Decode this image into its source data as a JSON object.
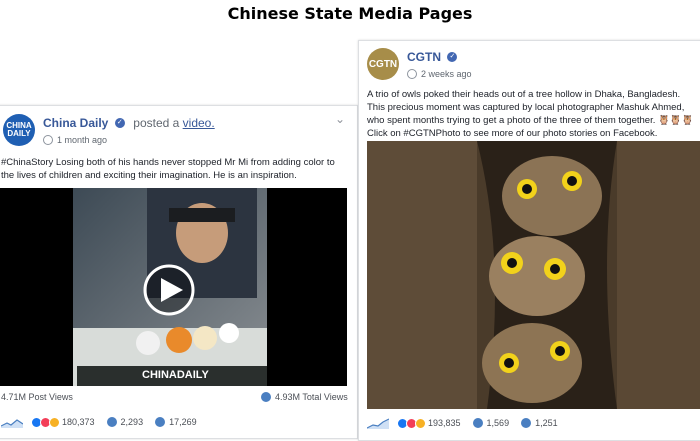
{
  "page_title": "Chinese State Media Pages",
  "posts": [
    {
      "page_name": "China Daily",
      "avatar_text": "CHINA DAILY",
      "action_prefix": "posted a",
      "action_link": "video.",
      "time": "1 month ago",
      "text": "#ChinaStory Losing both of his hands never stopped Mr Mi from adding color to the lives of children and exciting their imagination. He is an inspiration.",
      "watermark": "CHINADAILY",
      "post_views": "4.71M Post Views",
      "total_views": "4.93M Total Views",
      "reactions": "180,373",
      "comments": "2,293",
      "shares": "17,269"
    },
    {
      "page_name": "CGTN",
      "avatar_text": "CGTN",
      "time": "2 weeks ago",
      "text": "A trio of owls poked their heads out of a tree hollow in Dhaka, Bangladesh. This precious moment was captured by local photographer Mashuk Ahmed, who spent months trying to get a photo of the three of them together. 🦉🦉🦉 Click on #CGTNPhoto to see more of our photo stories on Facebook.",
      "reactions": "193,835",
      "comments": "1,569",
      "shares": "1,251"
    }
  ],
  "colors": {
    "link": "#385898",
    "verified": "#4267b2",
    "like": "#1877f2",
    "love": "#f33e58",
    "haha": "#f7b125"
  }
}
